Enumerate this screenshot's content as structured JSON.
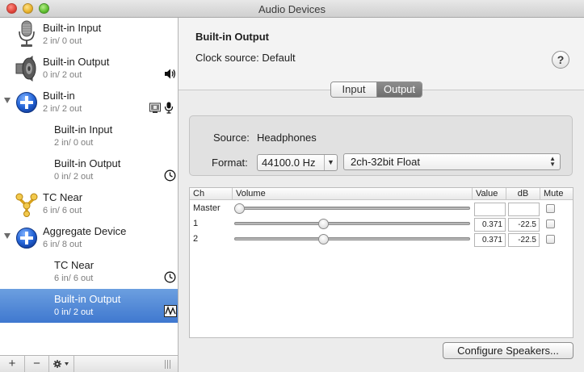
{
  "window": {
    "title": "Audio Devices"
  },
  "sidebar": {
    "devices": [
      {
        "name": "Built-in Input",
        "io": "2 in/ 0 out",
        "icon": "microphone-icon",
        "indent": 0,
        "disclosure": false,
        "right_icons": []
      },
      {
        "name": "Built-in Output",
        "io": "0 in/ 2 out",
        "icon": "speaker-icon",
        "indent": 0,
        "disclosure": false,
        "right_icons": [
          "speaker-volume-icon"
        ]
      },
      {
        "name": "Built-in",
        "io": "2 in/ 2 out",
        "icon": "aggregate-plus-icon",
        "indent": 0,
        "disclosure": true,
        "right_icons": [
          "system-output-icon",
          "microphone-small-icon"
        ]
      },
      {
        "name": "Built-in Input",
        "io": "2 in/ 0 out",
        "icon": "",
        "indent": 1,
        "disclosure": false,
        "right_icons": []
      },
      {
        "name": "Built-in Output",
        "io": "0 in/ 2 out",
        "icon": "",
        "indent": 1,
        "disclosure": false,
        "right_icons": [
          "clock-icon"
        ]
      },
      {
        "name": "TC Near",
        "io": "6 in/ 6 out",
        "icon": "firewire-icon",
        "indent": 0,
        "disclosure": false,
        "right_icons": []
      },
      {
        "name": "Aggregate Device",
        "io": "6 in/ 8 out",
        "icon": "aggregate-plus-icon",
        "indent": 0,
        "disclosure": true,
        "right_icons": []
      },
      {
        "name": "TC Near",
        "io": "6 in/ 6 out",
        "icon": "",
        "indent": 1,
        "disclosure": false,
        "right_icons": [
          "clock-icon"
        ]
      },
      {
        "name": "Built-in Output",
        "io": "0 in/ 2 out",
        "icon": "",
        "indent": 1,
        "disclosure": false,
        "right_icons": [
          "waveform-icon"
        ],
        "selected": true
      }
    ],
    "bottom": {
      "add": "+",
      "remove": "−"
    }
  },
  "main": {
    "device_title": "Built-in Output",
    "clock_label": "Clock source:",
    "clock_value": "Default",
    "help": "?",
    "tabs": [
      {
        "label": "Input",
        "active": false
      },
      {
        "label": "Output",
        "active": true
      }
    ],
    "source_label": "Source:",
    "source_value": "Headphones",
    "format_label": "Format:",
    "sample_rate": "44100.0 Hz",
    "bit_format": "2ch-32bit Float",
    "table": {
      "headers": {
        "ch": "Ch",
        "volume": "Volume",
        "value": "Value",
        "db": "dB",
        "mute": "Mute"
      },
      "rows": [
        {
          "ch": "Master",
          "level": 0.0,
          "value": "",
          "db": "",
          "mute": false
        },
        {
          "ch": "1",
          "level": 0.371,
          "value": "0.371",
          "db": "-22.5",
          "mute": false
        },
        {
          "ch": "2",
          "level": 0.371,
          "value": "0.371",
          "db": "-22.5",
          "mute": false
        }
      ]
    },
    "configure_label": "Configure Speakers..."
  }
}
